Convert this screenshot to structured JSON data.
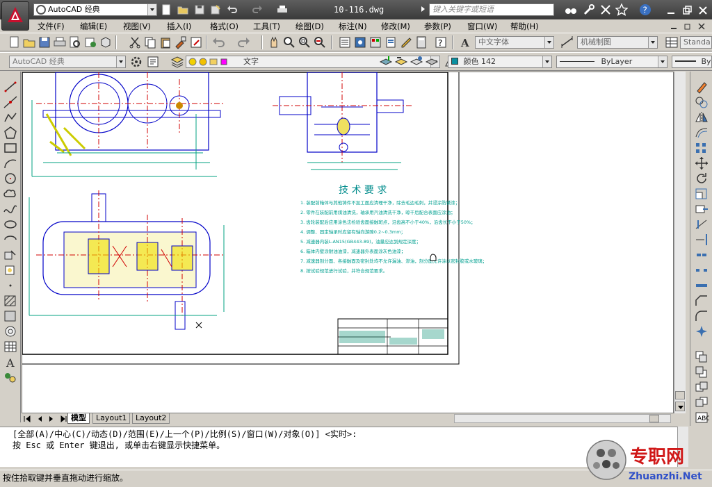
{
  "app": {
    "workspace": "AutoCAD 经典",
    "document_title": "10-116.dwg",
    "search_placeholder": "键入关键字或短语"
  },
  "menubar": {
    "items": [
      "文件(F)",
      "编辑(E)",
      "视图(V)",
      "插入(I)",
      "格式(O)",
      "工具(T)",
      "绘图(D)",
      "标注(N)",
      "修改(M)",
      "参数(P)",
      "窗口(W)",
      "帮助(H)"
    ]
  },
  "toolbars": {
    "text_style": "中文字体",
    "dim_style": "机械制图",
    "table_style": "Standa",
    "workspace2": "AutoCAD 经典",
    "layer_name": "文字",
    "color_label": "颜色 142",
    "linetype": "ByLayer",
    "lineweight": "By"
  },
  "drawing": {
    "tech_title": "技 术 要 求",
    "tech_lines": [
      "1. 装配前箱体与其他铸件不加工面应清理干净，除去毛边毛刺，并浸涂防锈漆；",
      "2. 零件在装配前用煤油清洗，轴承用汽油清洗干净，晾干后配合表面应涂油；",
      "3. 齿轮装配后应用涂色法检验齿面接触斑点，沿齿高不小于40%，沿齿长不小于50%；",
      "4. 调整、固定轴承时应留有轴向游隙0.2~0.3mm；",
      "5. 减速器内装L-AN15(GB443-89)，油量应达到规定深度；",
      "6. 箱体内壁涂耐油油漆，减速器外表面涂灰色油漆；",
      "7. 减速器剖分面、各接触面及密封处均不允许漏油、渗油，剖分面允许涂以密封胶或水玻璃；",
      "8. 按试验规范进行试验，并符合规范要求。"
    ]
  },
  "layout_tabs": [
    "模型",
    "Layout1",
    "Layout2"
  ],
  "command": {
    "line1": "[全部(A)/中心(C)/动态(D)/范围(E)/上一个(P)/比例(S)/窗口(W)/对象(O)] <实时>:",
    "line2": "按 Esc 或 Enter 键退出, 或单击右键显示快捷菜单。"
  },
  "status": {
    "text": "按住拾取键并垂直拖动进行缩放。"
  },
  "watermark": {
    "brand": "专职网",
    "url": "Zhuanzhi.Net"
  }
}
